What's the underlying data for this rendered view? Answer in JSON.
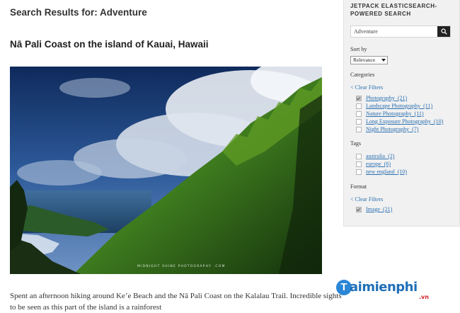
{
  "main": {
    "results_title": "Search Results for: Adventure",
    "post_title": "Nā Pali Coast on the island of Kauai, Hawaii",
    "photo_credit": "MIDNIGHT SHINE PHOTOGRAPHY .COM",
    "excerpt": "Spent an afternoon hiking around Ke’e Beach and the Nā Pali Coast on the Kalalau Trail. Incredible sights to be seen as this part of the island is a rainforest"
  },
  "sidebar": {
    "widget_title_line1": "JETPACK ELASTICSEARCH-",
    "widget_title_line2": "POWERED SEARCH",
    "search_value": "Adventure",
    "sort_label": "Sort by",
    "sort_value": "Relevance",
    "categories_label": "Categories",
    "categories_clear": "< Clear Filters",
    "categories": [
      {
        "label": "Photography",
        "count": "(21)",
        "checked": true
      },
      {
        "label": "Landscape Photography",
        "count": "(11)",
        "checked": false
      },
      {
        "label": "Nature Photography",
        "count": "(11)",
        "checked": false
      },
      {
        "label": "Long Exposure Photography",
        "count": "(10)",
        "checked": false
      },
      {
        "label": "Night Photography",
        "count": "(7)",
        "checked": false
      }
    ],
    "tags_label": "Tags",
    "tags": [
      {
        "label": "australia",
        "count": "(2)",
        "checked": false
      },
      {
        "label": "europe",
        "count": "(6)",
        "checked": false
      },
      {
        "label": "new england",
        "count": "(10)",
        "checked": false
      }
    ],
    "format_label": "Format",
    "format_clear": "< Clear Filters",
    "formats": [
      {
        "label": "Image",
        "count": "(21)",
        "checked": true
      }
    ]
  },
  "watermark": {
    "logo_letter": "T",
    "text": "aimienphi",
    "suffix": ".vn"
  },
  "colors": {
    "link": "#2a6fb0",
    "sidebar_bg": "#f1f1f1",
    "search_button": "#222222",
    "watermark_blue": "#1f6fb8",
    "watermark_red": "#d2232a"
  },
  "icons": {
    "search_button": "search-icon",
    "checkbox_checked": "check-icon",
    "select_arrow": "chevron-down-icon"
  }
}
